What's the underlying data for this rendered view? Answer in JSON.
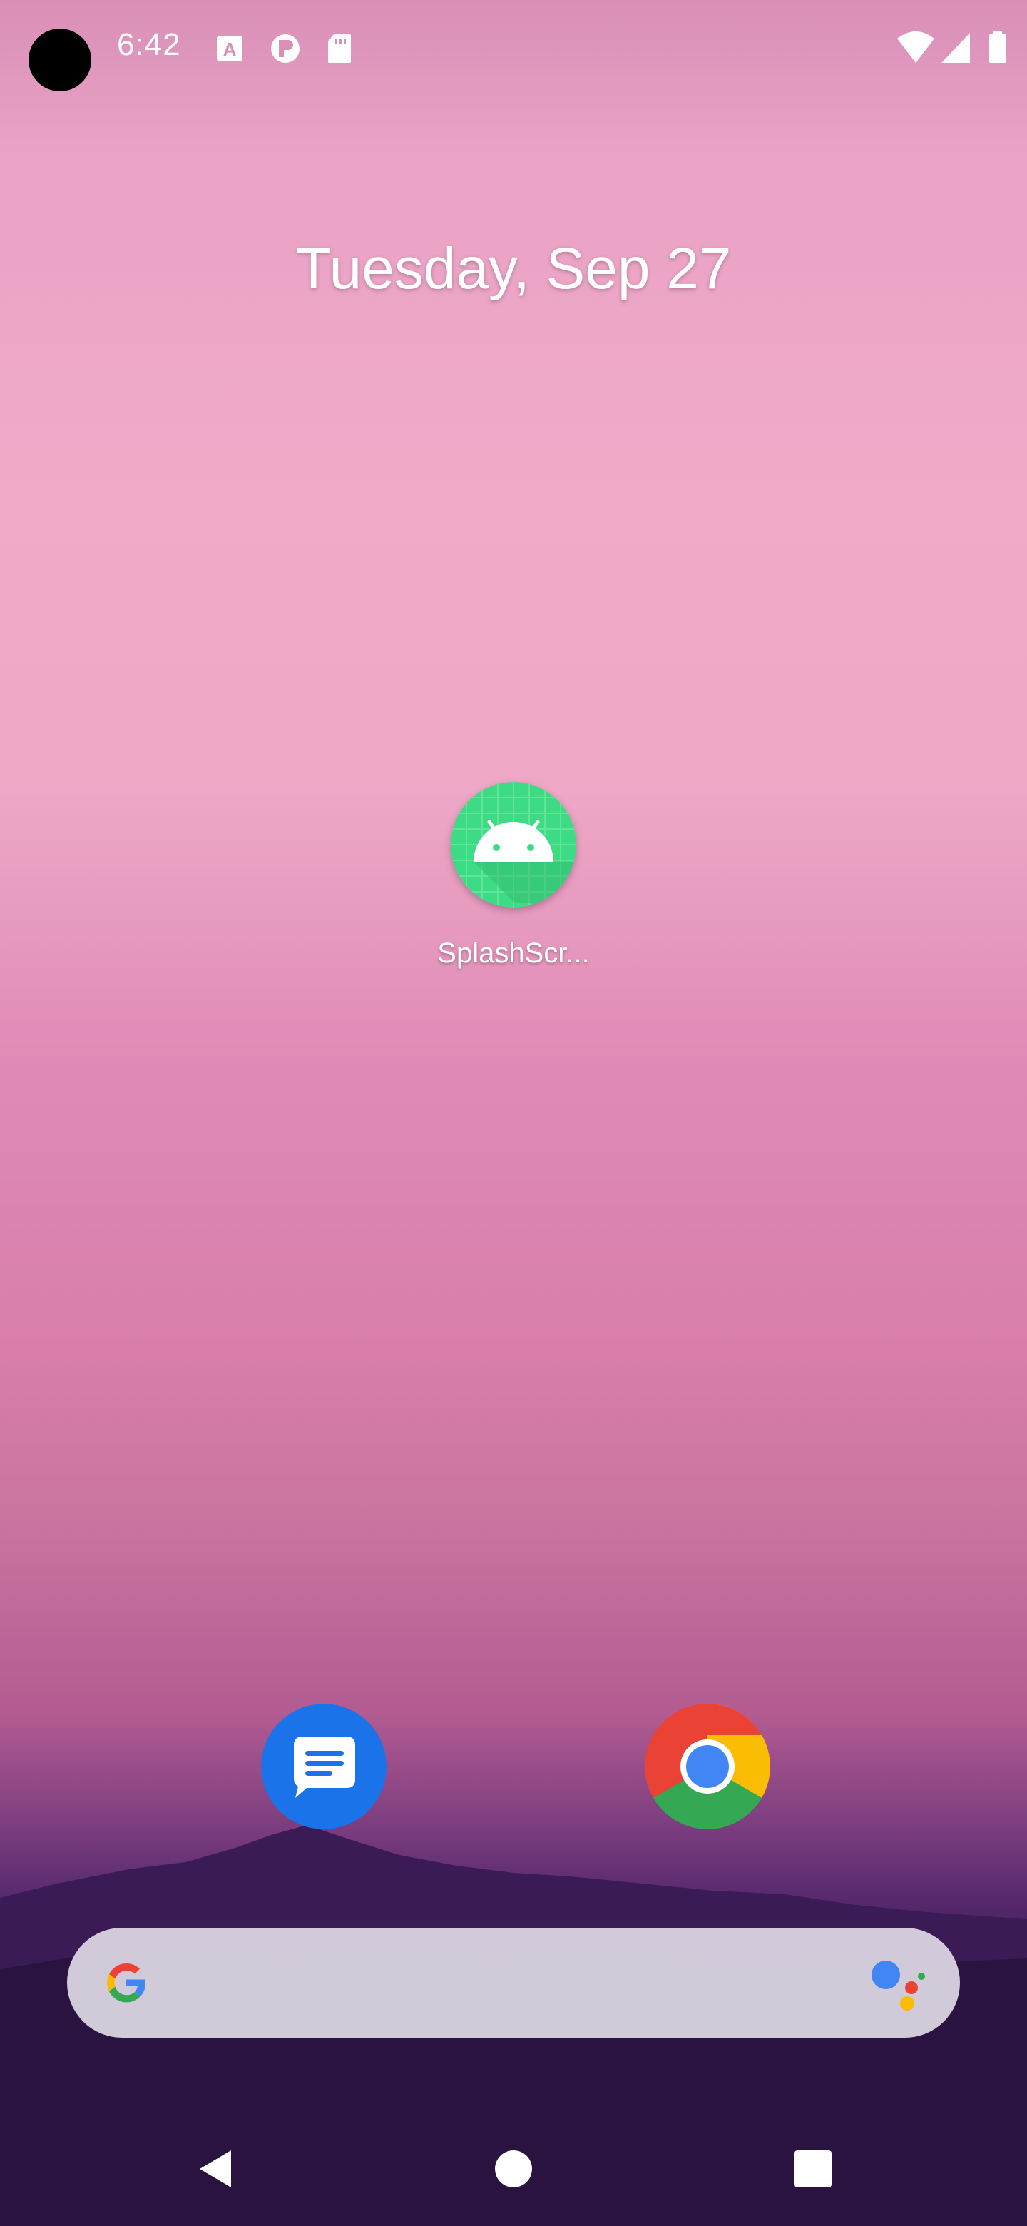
{
  "status_bar": {
    "time": "6:42",
    "notification_icons": [
      "text-a-icon",
      "settings-p-icon",
      "sd-card-icon"
    ],
    "system_icons": [
      "wifi-icon",
      "cell-signal-icon",
      "battery-icon"
    ]
  },
  "home": {
    "date": "Tuesday, Sep 27",
    "apps": [
      {
        "label": "SplashScr...",
        "icon": "android-icon"
      }
    ]
  },
  "dock": {
    "apps": [
      {
        "name": "messages",
        "icon": "messages-icon",
        "color": "#1a73e8"
      },
      {
        "name": "chrome",
        "icon": "chrome-icon"
      }
    ]
  },
  "search_bar": {
    "left_icon": "google-g-icon",
    "right_icon": "assistant-icon"
  },
  "nav_bar": {
    "buttons": [
      "back-icon",
      "home-icon",
      "recents-icon"
    ]
  },
  "colors": {
    "android_green": "#3ddc84",
    "search_bar_bg": "#dad4e2"
  }
}
